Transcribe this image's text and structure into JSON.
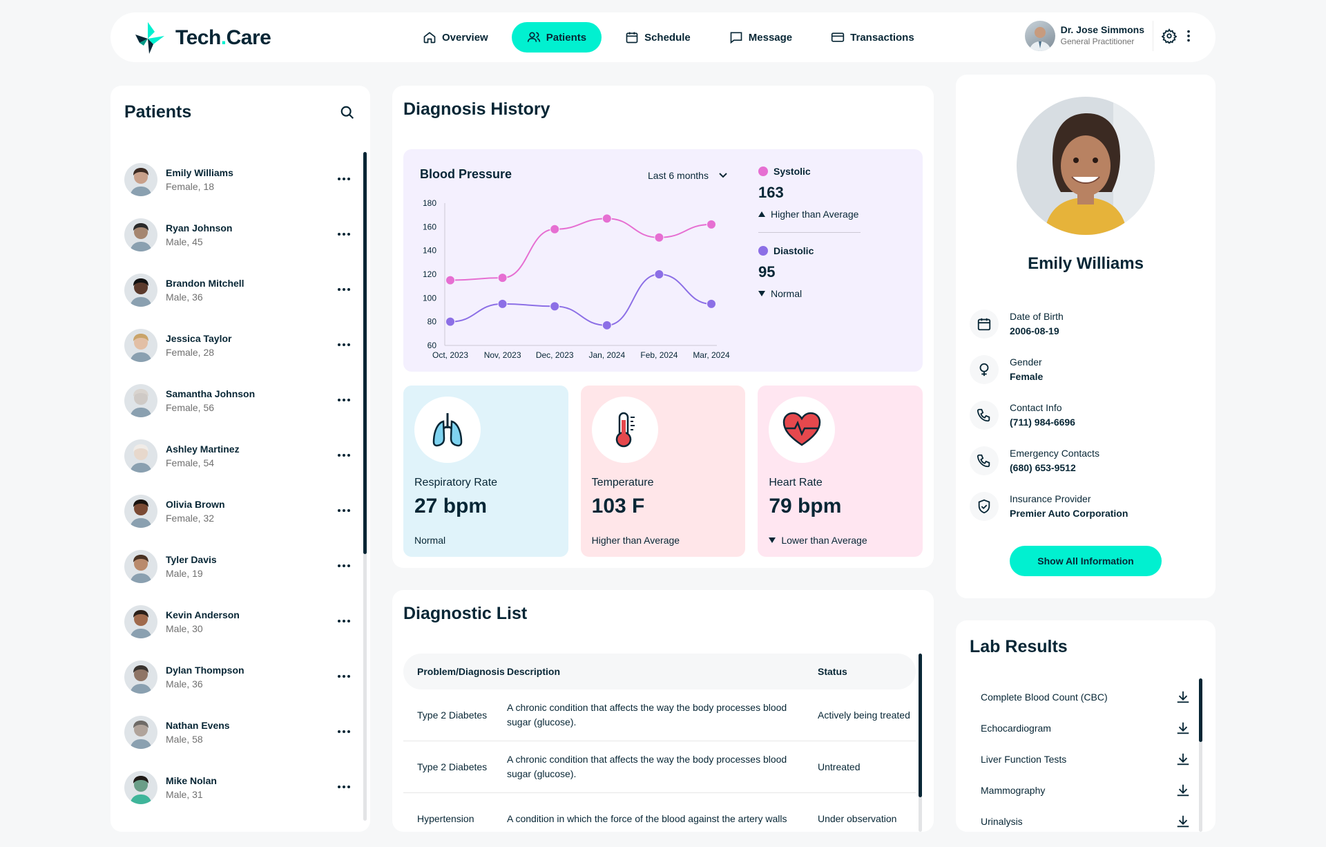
{
  "brand": {
    "name_part1": "Tech",
    "name_dot": ".",
    "name_part2": "Care",
    "accent": "#01f0d0",
    "dark": "#072635"
  },
  "nav": [
    {
      "label": "Overview",
      "icon": "home-icon",
      "active": false
    },
    {
      "label": "Patients",
      "icon": "users-icon",
      "active": true
    },
    {
      "label": "Schedule",
      "icon": "calendar-icon",
      "active": false
    },
    {
      "label": "Message",
      "icon": "message-icon",
      "active": false
    },
    {
      "label": "Transactions",
      "icon": "credit-card-icon",
      "active": false
    }
  ],
  "doctor": {
    "name": "Dr. Jose Simmons",
    "role": "General Practitioner"
  },
  "patients": {
    "title": "Patients",
    "list": [
      {
        "name": "Emily Williams",
        "detail": "Female, 18"
      },
      {
        "name": "Ryan Johnson",
        "detail": "Male, 45"
      },
      {
        "name": "Brandon Mitchell",
        "detail": "Male, 36"
      },
      {
        "name": "Jessica Taylor",
        "detail": "Female, 28"
      },
      {
        "name": "Samantha Johnson",
        "detail": "Female, 56"
      },
      {
        "name": "Ashley Martinez",
        "detail": "Female, 54"
      },
      {
        "name": "Olivia Brown",
        "detail": "Female, 32"
      },
      {
        "name": "Tyler Davis",
        "detail": "Male, 19"
      },
      {
        "name": "Kevin Anderson",
        "detail": "Male, 30"
      },
      {
        "name": "Dylan Thompson",
        "detail": "Male, 36"
      },
      {
        "name": "Nathan Evens",
        "detail": "Male, 58"
      },
      {
        "name": "Mike Nolan",
        "detail": "Male, 31"
      }
    ]
  },
  "history": {
    "title": "Diagnosis History",
    "bp_title": "Blood Pressure",
    "range": "Last 6 months",
    "systolic": {
      "label": "Systolic",
      "value": "163",
      "note": "Higher than Average",
      "color": "#e66fd2"
    },
    "diastolic": {
      "label": "Diastolic",
      "value": "95",
      "note": "Normal",
      "color": "#8c6fe6"
    }
  },
  "chart_data": {
    "type": "line",
    "categories": [
      "Oct, 2023",
      "Nov, 2023",
      "Dec, 2023",
      "Jan, 2024",
      "Feb, 2024",
      "Mar, 2024"
    ],
    "series": [
      {
        "name": "Systolic",
        "values": [
          115,
          117,
          158,
          167,
          151,
          162
        ],
        "color": "#e66fd2"
      },
      {
        "name": "Diastolic",
        "values": [
          80,
          95,
          93,
          77,
          120,
          95
        ],
        "color": "#8c6fe6"
      }
    ],
    "yticks": [
      60,
      80,
      100,
      120,
      140,
      160,
      180
    ],
    "ylim": [
      60,
      180
    ],
    "grid": false
  },
  "vitals": [
    {
      "label": "Respiratory Rate",
      "value": "27 bpm",
      "note": "Normal",
      "bg": "#e0f3fa",
      "icon": "lungs-icon",
      "arrow": false
    },
    {
      "label": "Temperature",
      "value": "103 F",
      "note": "Higher than Average",
      "bg": "#ffe6e9",
      "icon": "thermometer-icon",
      "arrow": false
    },
    {
      "label": "Heart Rate",
      "value": "79 bpm",
      "note": "Lower than Average",
      "bg": "#ffe6f1",
      "icon": "heart-icon",
      "arrow": true
    }
  ],
  "diagnostic": {
    "title": "Diagnostic List",
    "headers": [
      "Problem/Diagnosis",
      "Description",
      "Status"
    ],
    "rows": [
      {
        "problem": "Type 2 Diabetes",
        "description": "A chronic condition that affects the way the body processes blood sugar (glucose).",
        "status": "Actively being treated"
      },
      {
        "problem": "Type 2 Diabetes",
        "description": "A chronic condition that affects the way the body processes blood sugar (glucose).",
        "status": "Untreated"
      },
      {
        "problem": "Hypertension",
        "description": "A condition in which the force of the blood against the artery walls",
        "status": "Under observation"
      }
    ]
  },
  "profile": {
    "name": "Emily Williams",
    "fields": [
      {
        "label": "Date of Birth",
        "value": "2006-08-19",
        "icon": "calendar-icon"
      },
      {
        "label": "Gender",
        "value": "Female",
        "icon": "female-icon"
      },
      {
        "label": "Contact Info",
        "value": "(711) 984-6696",
        "icon": "phone-icon"
      },
      {
        "label": "Emergency Contacts",
        "value": "(680) 653-9512",
        "icon": "phone-icon"
      },
      {
        "label": "Insurance Provider",
        "value": "Premier Auto Corporation",
        "icon": "shield-icon"
      }
    ],
    "button": "Show All Information"
  },
  "lab": {
    "title": "Lab Results",
    "items": [
      "Complete Blood Count (CBC)",
      "Echocardiogram",
      "Liver Function Tests",
      "Mammography",
      "Urinalysis"
    ]
  }
}
